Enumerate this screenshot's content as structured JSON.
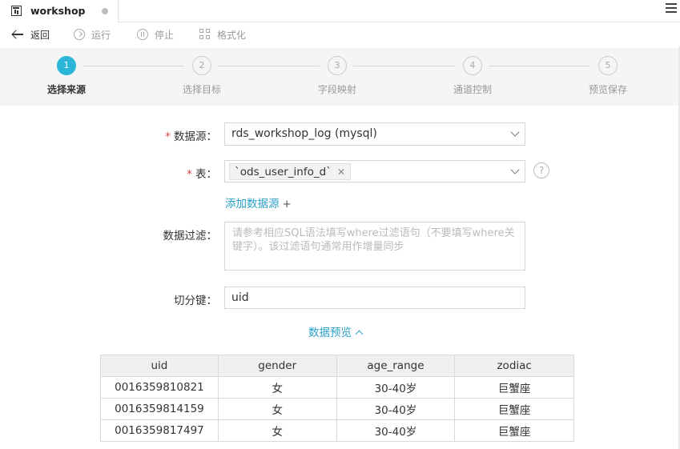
{
  "tab": {
    "title": "workshop"
  },
  "toolbar": {
    "back": "返回",
    "run": "运行",
    "stop": "停止",
    "format": "格式化"
  },
  "steps": [
    {
      "num": "1",
      "label": "选择来源",
      "active": true
    },
    {
      "num": "2",
      "label": "选择目标",
      "active": false
    },
    {
      "num": "3",
      "label": "字段映射",
      "active": false
    },
    {
      "num": "4",
      "label": "通道控制",
      "active": false
    },
    {
      "num": "5",
      "label": "预览保存",
      "active": false
    }
  ],
  "form": {
    "datasource_label": "数据源：",
    "datasource_value": "rds_workshop_log (mysql)",
    "table_label": "表：",
    "table_tag": "`ods_user_info_d`",
    "help": "?",
    "add_datasource": "添加数据源",
    "add_plus": "+",
    "filter_label": "数据过滤：",
    "filter_placeholder": "请参考相应SQL语法填写where过滤语句（不要填写where关键字）。该过滤语句通常用作增量同步",
    "split_key_label": "切分键：",
    "split_key_value": "uid",
    "preview_link": "数据预览"
  },
  "preview_table": {
    "columns": [
      "uid",
      "gender",
      "age_range",
      "zodiac"
    ],
    "rows": [
      [
        "0016359810821",
        "女",
        "30-40岁",
        "巨蟹座"
      ],
      [
        "0016359814159",
        "女",
        "30-40岁",
        "巨蟹座"
      ],
      [
        "0016359817497",
        "女",
        "30-40岁",
        "巨蟹座"
      ]
    ]
  },
  "colors": {
    "accent": "#2ab5d9",
    "link": "#2aa0c8",
    "required": "#e04040"
  }
}
